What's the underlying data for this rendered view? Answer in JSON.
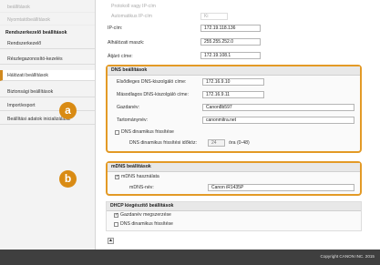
{
  "sidebar": {
    "items": [
      {
        "label": "beállítások"
      },
      {
        "label": "Nyomtatóbeállítások"
      },
      {
        "label": "Rendszerkezelő beállítások"
      },
      {
        "label": "Rendszerkezelő"
      },
      {
        "label": "Részlegazonosító-kezelés"
      },
      {
        "label": "Hálózati beállítások"
      },
      {
        "label": "Biztonsági beállítások"
      },
      {
        "label": "Import/export"
      },
      {
        "label": "Beállítási adatok inicializálása"
      }
    ]
  },
  "top": {
    "rows": [
      {
        "label": "Protokoll vagy IP-cím",
        "value": ""
      },
      {
        "label": "Automatikus IP-cím",
        "value": "Ki"
      },
      {
        "label": "IP-cím:",
        "value": "172.19.118.136"
      },
      {
        "label": "Alhálózati maszk:",
        "value": "255.255.252.0"
      },
      {
        "label": "Átjáró címe:",
        "value": "172.19.108.1"
      }
    ]
  },
  "dns": {
    "title": "DNS beállítások",
    "primary_label": "Elsődleges DNS-kiszolgáló címe:",
    "primary_value": "172.16.9.10",
    "secondary_label": "Másodlagos DNS-kiszolgáló címe:",
    "secondary_value": "172.16.9.11",
    "host_label": "Gazdanév:",
    "host_value": "Canon8b597",
    "domain_label": "Tartománynév:",
    "domain_value": "canonmitra.net",
    "dyn_label": "DNS dinamikus frissítése",
    "interval_label": "DNS dinamikus frissítési időköz:",
    "interval_value": "24",
    "interval_unit": "óra (0-48)",
    "marker": "a"
  },
  "mdns": {
    "title": "mDNS beállítások",
    "use_label": "mDNS használata",
    "name_label": "mDNS-név:",
    "name_value": "Canon iR1435P",
    "marker": "b"
  },
  "dhcp": {
    "title": "DHCP kiegészítő beállítások",
    "host_label": "Gazdanév megszerzése",
    "dyn_label": "DNS dinamikus frissítése"
  },
  "footer": {
    "copyright": "Copyright CANON INC. 2015"
  },
  "colors": {
    "accent": "#e39a26",
    "marker": "#d98b14",
    "footer": "#3f3f3f"
  }
}
